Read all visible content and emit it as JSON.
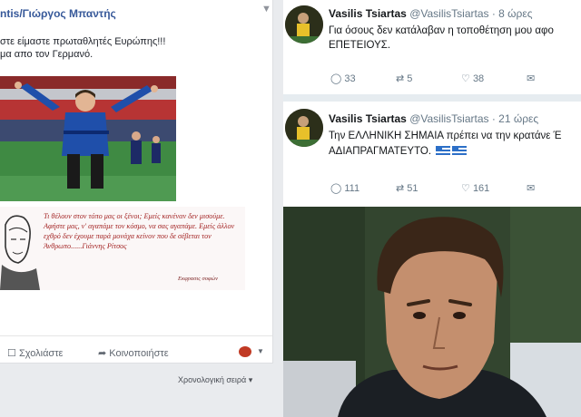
{
  "facebook": {
    "author": "ntis/Γιώργος Μπαντής",
    "post_lines": [
      "στε είμαστε πρωταθλητές Ευρώπης!!!",
      "μα απο τον Γερμανό."
    ],
    "poem": "Τι θέλουν στον τόπο μας οι ξένοι; Εμείς κανέναν δεν μισούμε. Αφήστε μας, ν' αγαπάμε τον κόσμο, να σας αγαπάμε. Εμείς άλλον εχθρό δεν έχουμε παρά μονάχα κείνον που δε σέβεται τον Άνθρωπο......Γιάννης Ρίτσος",
    "poem_signature": "Εκφρασις σοφών",
    "comment_label": "Σχολιάστε",
    "share_label": "Κοινοποιήστε",
    "sort_label": "Χρονολογική σειρά ▾"
  },
  "tweets": [
    {
      "name": "Vasilis Tsiartas",
      "handle": "@VasilisTsiartas · 8 ώρες",
      "lines": [
        "Για όσους δεν κατάλαβαν η τοποθέτηση μου αφο",
        "ΕΠΕΤΕΙΟΥΣ."
      ],
      "replies": "33",
      "retweets": "5",
      "likes": "38"
    },
    {
      "name": "Vasilis Tsiartas",
      "handle": "@VasilisTsiartas · 21 ώρες",
      "lines": [
        "Την ΕΛΛΗΝΙΚΗ ΣΗΜΑΙΑ πρέπει να την κρατάνε Έ",
        "ΑΔΙΑΠΡΑΓΜΑΤΕΥΤΟ."
      ],
      "replies": "111",
      "retweets": "51",
      "likes": "161"
    }
  ],
  "colors": {
    "fb_link": "#365899",
    "poem_red": "#a42525",
    "tw_gray": "#657786",
    "greek_blue": "#2c6fc7"
  }
}
